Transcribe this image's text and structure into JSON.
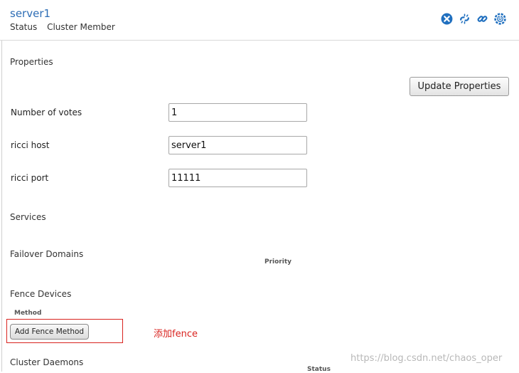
{
  "header": {
    "node_name": "server1",
    "status_label": "Status",
    "status_value": "Cluster Member",
    "icons": [
      "delete-icon",
      "leave-cluster-icon",
      "join-cluster-icon",
      "reboot-icon"
    ]
  },
  "properties": {
    "title": "Properties",
    "update_label": "Update Properties",
    "fields": [
      {
        "label": "Number of votes",
        "value": "1"
      },
      {
        "label": "ricci host",
        "value": "server1"
      },
      {
        "label": "ricci port",
        "value": "11111"
      }
    ]
  },
  "services": {
    "title": "Services"
  },
  "failover": {
    "title": "Failover Domains",
    "priority_header": "Priority"
  },
  "fence": {
    "title": "Fence Devices",
    "method_header": "Method",
    "add_label": "Add Fence Method"
  },
  "annotation": "添加fence",
  "daemons": {
    "title": "Cluster Daemons",
    "status_header": "Status"
  },
  "watermark": "https://blog.csdn.net/chaos_oper",
  "colors": {
    "link": "#2d6db5",
    "annotation": "#d9231f",
    "icon": "#1f6fbf"
  }
}
